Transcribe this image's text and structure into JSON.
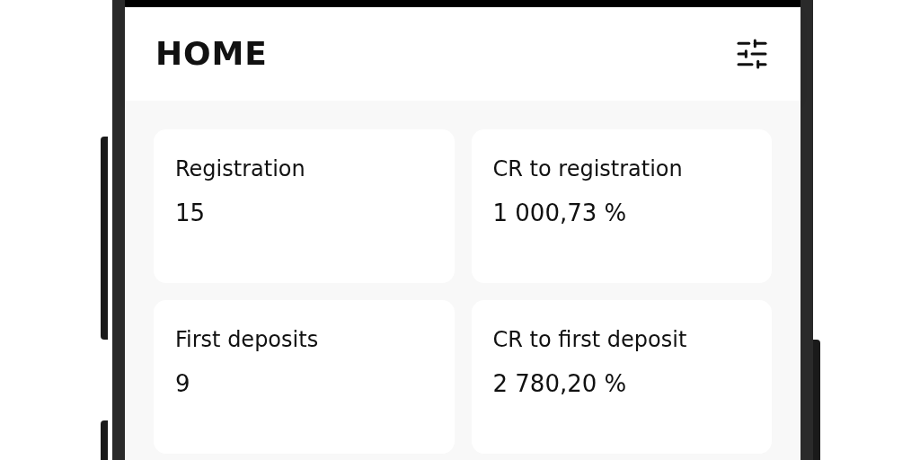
{
  "header": {
    "title": "HOME"
  },
  "cards": [
    {
      "label": "Registration",
      "value": "15"
    },
    {
      "label": "CR to registration",
      "value": "1 000,73 %"
    },
    {
      "label": "First deposits",
      "value": "9"
    },
    {
      "label": "CR to first deposit",
      "value": "2 780,20 %"
    }
  ]
}
